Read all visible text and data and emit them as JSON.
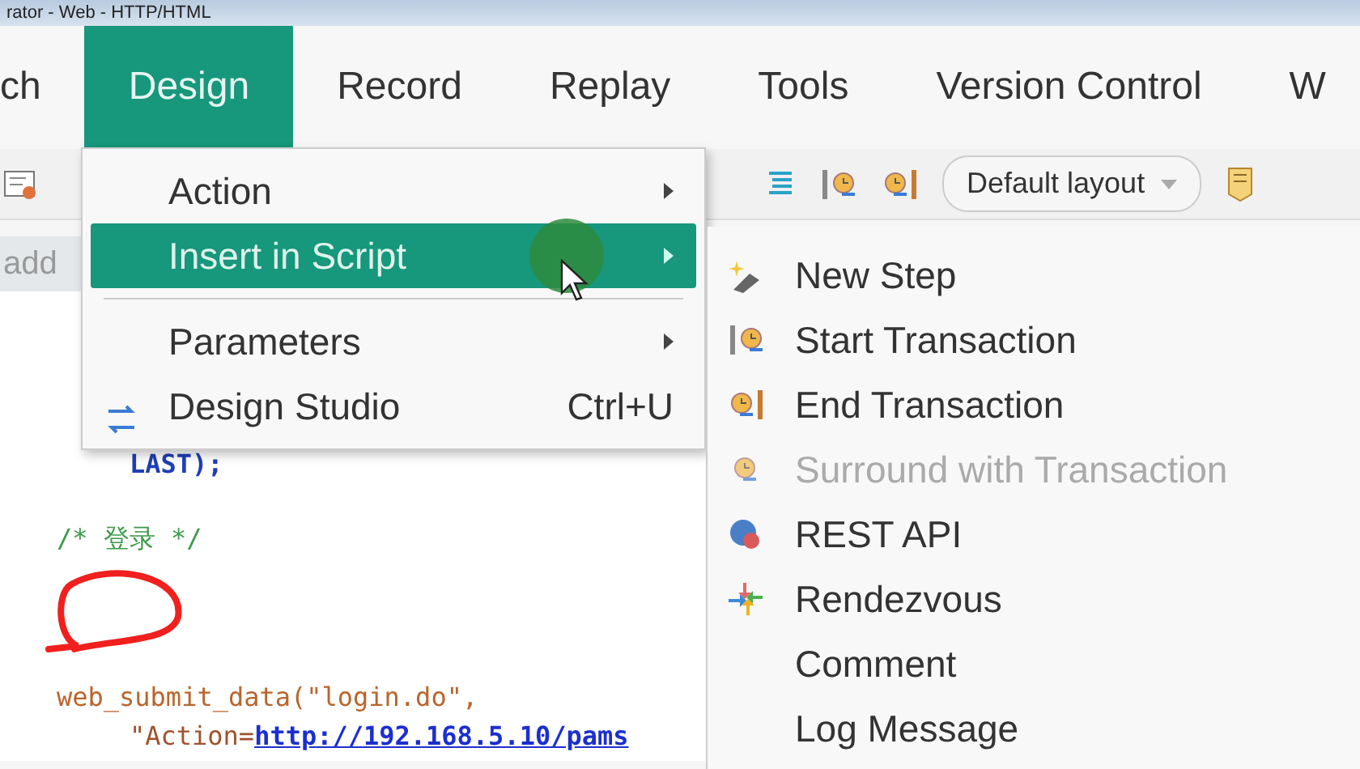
{
  "window": {
    "title": "rator - Web - HTTP/HTML"
  },
  "menu_bar": [
    {
      "label": "ch",
      "selected": false
    },
    {
      "label": "Design",
      "selected": true
    },
    {
      "label": "Record",
      "selected": false
    },
    {
      "label": "Replay",
      "selected": false
    },
    {
      "label": "Tools",
      "selected": false
    },
    {
      "label": "Version Control",
      "selected": false
    },
    {
      "label": "W",
      "selected": false
    }
  ],
  "toolbar": {
    "layout_dropdown": "Default layout"
  },
  "search_field": {
    "value": "add"
  },
  "design_menu": [
    {
      "kind": "item",
      "label": "Action",
      "submenu": true,
      "selected": false
    },
    {
      "kind": "item",
      "label": "Insert in Script",
      "submenu": true,
      "selected": true
    },
    {
      "kind": "separator"
    },
    {
      "kind": "item",
      "label": "Parameters",
      "submenu": true,
      "selected": false
    },
    {
      "kind": "item",
      "label": "Design Studio",
      "shortcut": "Ctrl+U",
      "submenu": false,
      "selected": false
    }
  ],
  "insert_submenu": [
    {
      "label": "New Step",
      "disabled": false
    },
    {
      "label": "Start Transaction",
      "disabled": false
    },
    {
      "label": "End Transaction",
      "disabled": false
    },
    {
      "label": "Surround with Transaction",
      "disabled": true
    },
    {
      "label": "REST API",
      "disabled": false
    },
    {
      "label": "Rendezvous",
      "disabled": false
    },
    {
      "label": "Comment",
      "disabled": false
    },
    {
      "label": "Log Message",
      "disabled": false
    }
  ],
  "code": [
    {
      "kind": "keyword",
      "text": "LAST);"
    },
    {
      "kind": "comment",
      "text": "/* 登录 */"
    },
    {
      "kind": "blank"
    },
    {
      "kind": "function",
      "text": "web_submit_data(\"login.do\","
    },
    {
      "kind": "param",
      "text": "\"Action=",
      "link": "http://192.168.5.10/pams"
    }
  ]
}
